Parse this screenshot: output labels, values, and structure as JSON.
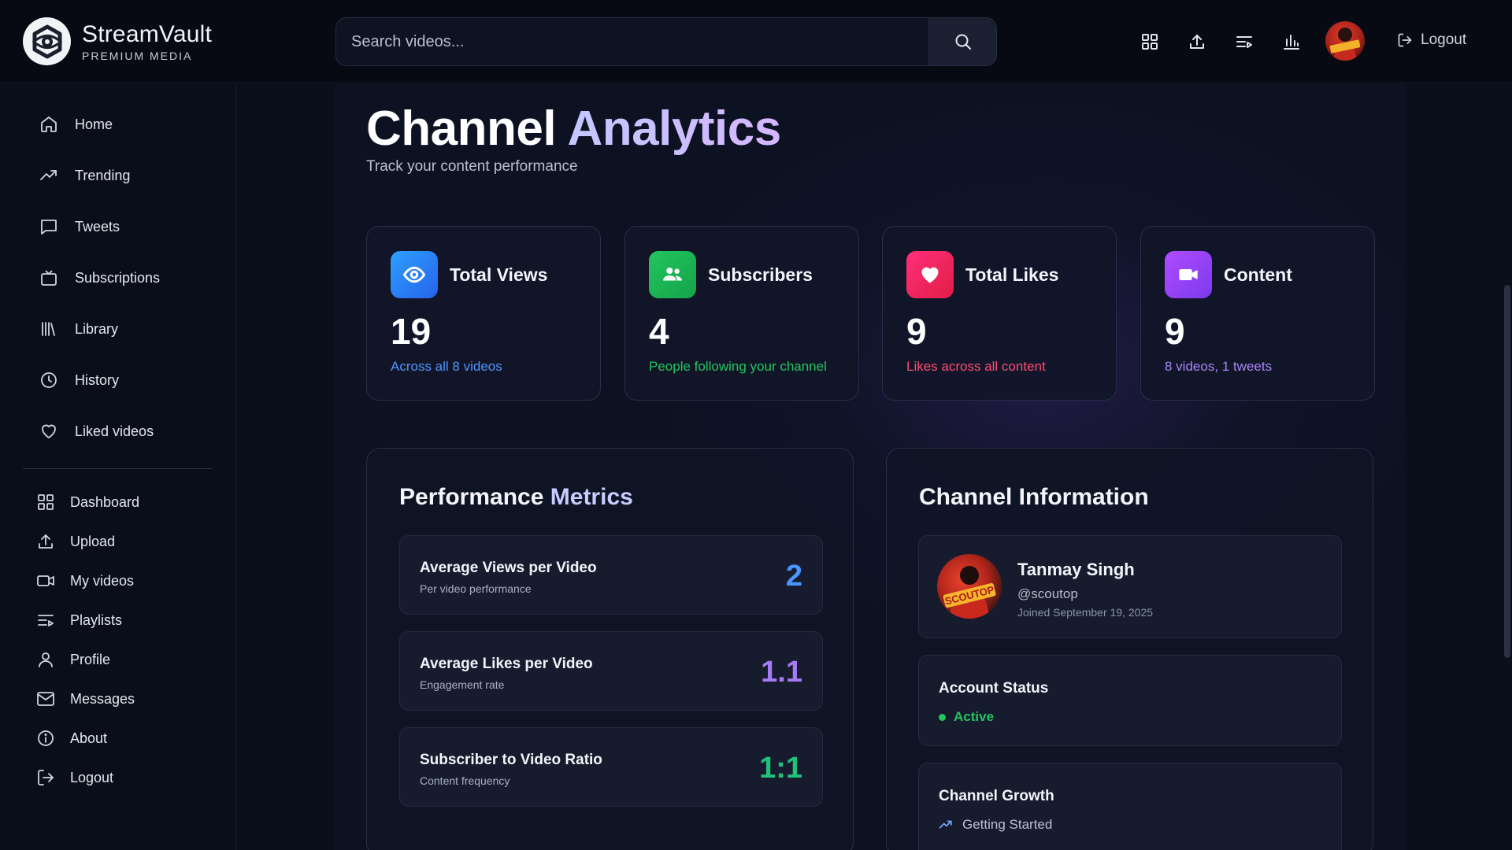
{
  "app": {
    "name": "StreamVault",
    "tagline": "PREMIUM MEDIA"
  },
  "search": {
    "placeholder": "Search videos..."
  },
  "header": {
    "logout_label": "Logout"
  },
  "sidebar": {
    "primary": [
      {
        "label": "Home",
        "icon": "home-icon"
      },
      {
        "label": "Trending",
        "icon": "trending-icon"
      },
      {
        "label": "Tweets",
        "icon": "tweets-icon"
      },
      {
        "label": "Subscriptions",
        "icon": "subscriptions-icon"
      },
      {
        "label": "Library",
        "icon": "library-icon"
      },
      {
        "label": "History",
        "icon": "history-icon"
      },
      {
        "label": "Liked videos",
        "icon": "heart-icon"
      }
    ],
    "secondary": [
      {
        "label": "Dashboard",
        "icon": "dashboard-icon"
      },
      {
        "label": "Upload",
        "icon": "upload-icon"
      },
      {
        "label": "My videos",
        "icon": "video-icon"
      },
      {
        "label": "Playlists",
        "icon": "playlists-icon"
      },
      {
        "label": "Profile",
        "icon": "profile-icon"
      },
      {
        "label": "Messages",
        "icon": "messages-icon"
      },
      {
        "label": "About",
        "icon": "about-icon"
      },
      {
        "label": "Logout",
        "icon": "logout-icon"
      }
    ]
  },
  "page": {
    "title_main": "Channel",
    "title_accent": "Analytics",
    "subtitle": "Track your content performance"
  },
  "stats": [
    {
      "label": "Total Views",
      "value": "19",
      "sub": "Across all 8 videos",
      "icon": "eye-icon",
      "color": "#2f86f6",
      "sub_color": "#4f97ff"
    },
    {
      "label": "Subscribers",
      "value": "4",
      "sub": "People following your channel",
      "icon": "users-icon",
      "color": "#1fb45f",
      "sub_color": "#22c55e"
    },
    {
      "label": "Total Likes",
      "value": "9",
      "sub": "Likes across all content",
      "icon": "heart-icon",
      "color": "#f0255f",
      "sub_color": "#fb4d72"
    },
    {
      "label": "Content",
      "value": "9",
      "sub": "8 videos, 1 tweets",
      "icon": "camera-icon",
      "color": "#9b40f2",
      "sub_color": "#a986f5"
    }
  ],
  "performance": {
    "title_main": "Performance",
    "title_accent": "Metrics",
    "metrics": [
      {
        "title": "Average Views per Video",
        "sub": "Per video performance",
        "value": "2",
        "color": "#4a95ff"
      },
      {
        "title": "Average Likes per Video",
        "sub": "Engagement rate",
        "value": "1.1",
        "color": "#a47cf3"
      },
      {
        "title": "Subscriber to Video Ratio",
        "sub": "Content frequency",
        "value": "1:1",
        "color": "#20c27a"
      }
    ]
  },
  "channel": {
    "title": "Channel Information",
    "name": "Tanmay Singh",
    "handle": "@scoutop",
    "joined": "Joined September 19, 2025",
    "avatar_text": "SCOUTOP",
    "account_status_label": "Account Status",
    "account_status": "Active",
    "growth_label": "Channel Growth",
    "growth_value": "Getting Started"
  }
}
